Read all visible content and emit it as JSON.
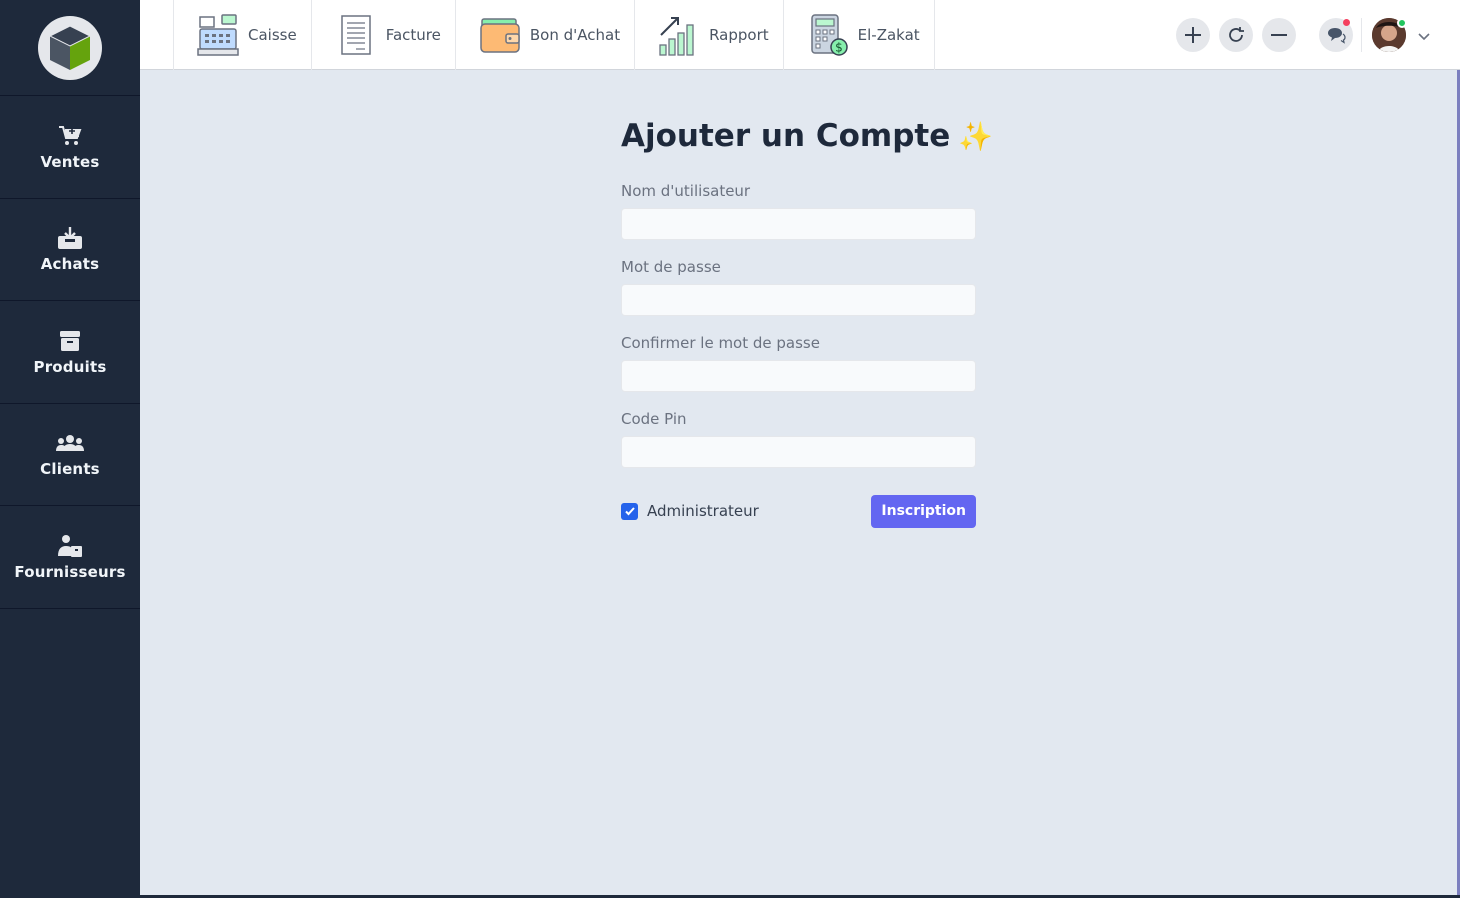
{
  "sidebar": {
    "logo": "cube-logo",
    "items": [
      {
        "label": "Ventes",
        "icon": "cart-icon"
      },
      {
        "label": "Achats",
        "icon": "inbox-download-icon"
      },
      {
        "label": "Produits",
        "icon": "archive-box-icon"
      },
      {
        "label": "Clients",
        "icon": "users-icon"
      },
      {
        "label": "Fournisseurs",
        "icon": "supplier-icon"
      }
    ]
  },
  "topnav": {
    "items": [
      {
        "label": "Caisse",
        "icon": "cash-register-icon"
      },
      {
        "label": "Facture",
        "icon": "invoice-icon"
      },
      {
        "label": "Bon d'Achat",
        "icon": "wallet-icon"
      },
      {
        "label": "Rapport",
        "icon": "growth-chart-icon"
      },
      {
        "label": "El-Zakat",
        "icon": "calculator-icon"
      }
    ],
    "tools": [
      "plus-icon",
      "refresh-icon",
      "minus-icon",
      "chat-icon",
      "avatar",
      "chevron-down-icon"
    ]
  },
  "form": {
    "title": "Ajouter un Compte",
    "title_emoji": "✨",
    "fields": [
      {
        "label": "Nom d'utilisateur",
        "value": "",
        "placeholder": ""
      },
      {
        "label": "Mot de passe",
        "value": "",
        "placeholder": ""
      },
      {
        "label": "Confirmer le mot de passe",
        "value": "",
        "placeholder": ""
      },
      {
        "label": "Code Pin",
        "value": "",
        "placeholder": ""
      }
    ],
    "admin_checkbox": {
      "label": "Administrateur",
      "checked": true
    },
    "submit_label": "Inscription"
  },
  "colors": {
    "sidebar_bg": "#1e293b",
    "content_bg": "#e2e8f0",
    "accent": "#6366f1",
    "checkbox": "#2563eb"
  }
}
